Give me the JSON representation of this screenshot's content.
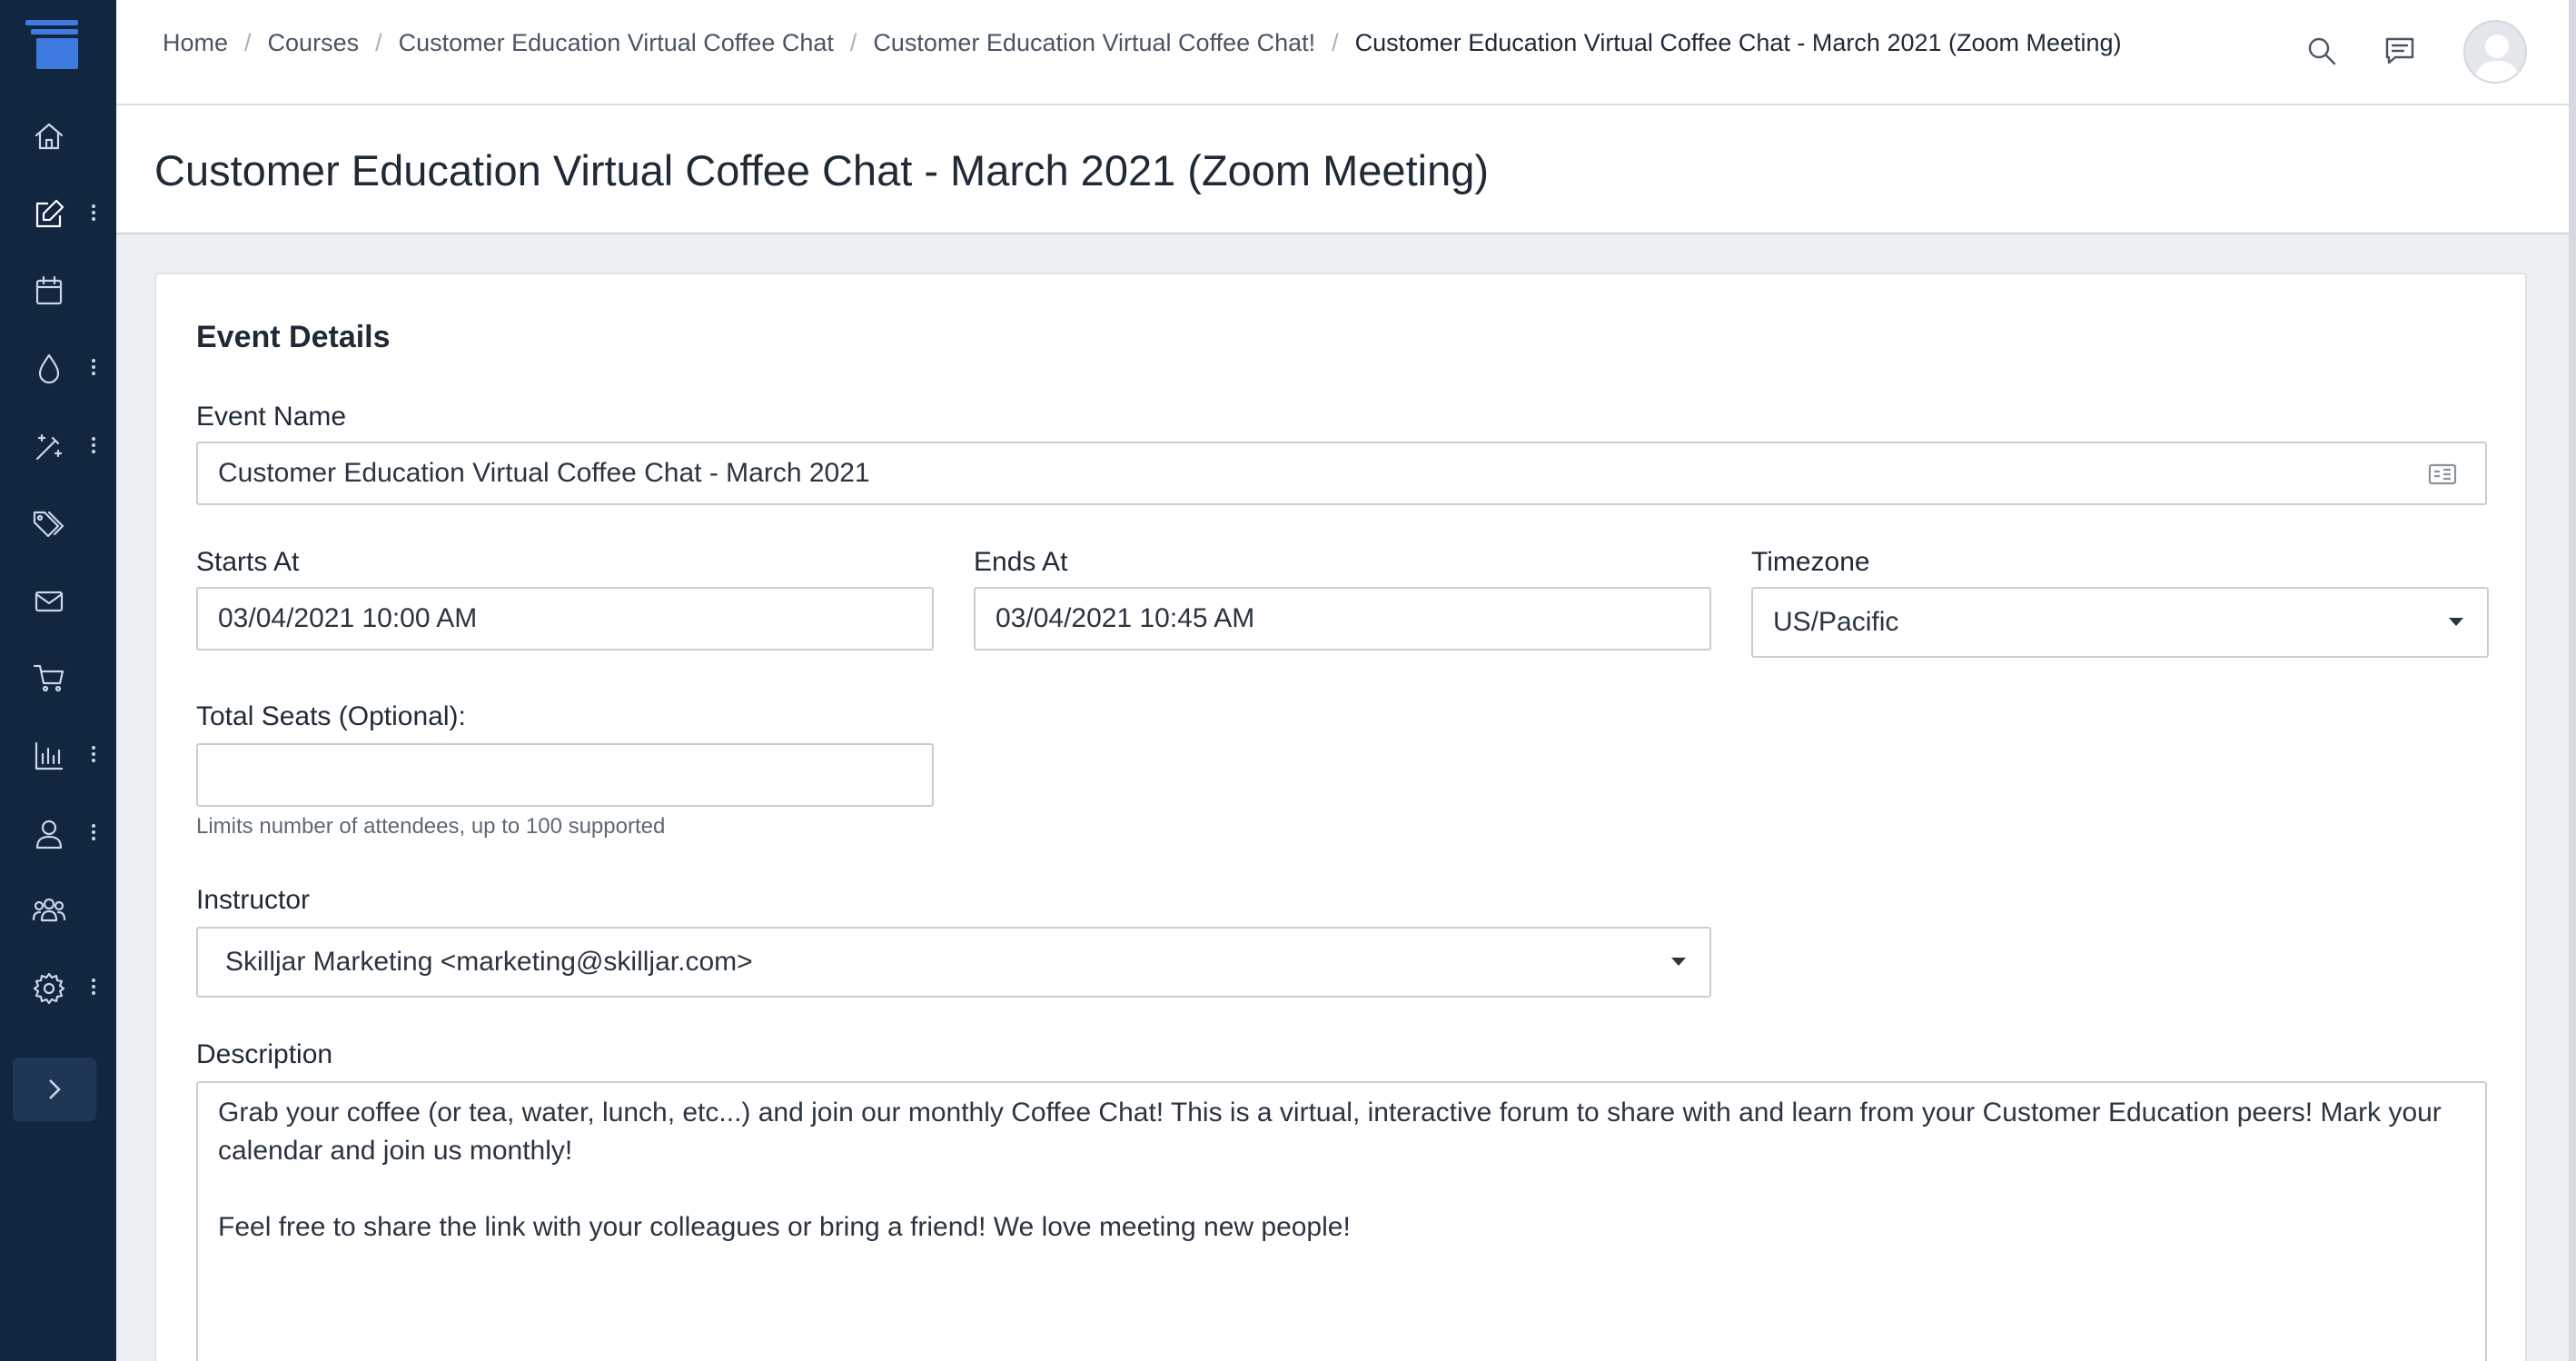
{
  "breadcrumb": {
    "items": [
      "Home",
      "Courses",
      "Customer Education Virtual Coffee Chat",
      "Customer Education Virtual Coffee Chat!"
    ],
    "current": "Customer Education Virtual Coffee Chat - March 2021 (Zoom Meeting)",
    "separator": "/"
  },
  "page": {
    "title": "Customer Education Virtual Coffee Chat - March 2021 (Zoom Meeting)"
  },
  "form": {
    "section_title": "Event Details",
    "event_name": {
      "label": "Event Name",
      "value": "Customer Education Virtual Coffee Chat - March 2021"
    },
    "starts_at": {
      "label": "Starts At",
      "value": "03/04/2021 10:00 AM"
    },
    "ends_at": {
      "label": "Ends At",
      "value": "03/04/2021 10:45 AM"
    },
    "timezone": {
      "label": "Timezone",
      "value": "US/Pacific"
    },
    "total_seats": {
      "label": "Total Seats (Optional):",
      "value": "",
      "hint": "Limits number of attendees, up to 100 supported"
    },
    "instructor": {
      "label": "Instructor",
      "value": "Skilljar Marketing <marketing@skilljar.com>"
    },
    "description": {
      "label": "Description",
      "paragraph_1": "Grab your coffee (or tea, water, lunch, etc...) and join our monthly Coffee Chat! This is a virtual, interactive forum to share with and learn from your Customer Education peers! Mark your calendar and join us monthly!",
      "paragraph_2": "Feel free to share the link with your colleagues or bring a friend! We love meeting new people!"
    }
  },
  "sidebar": {
    "icons": [
      "home-icon",
      "edit-icon",
      "calendar-icon",
      "droplet-icon",
      "magic-wand-icon",
      "tags-icon",
      "mail-icon",
      "cart-icon",
      "analytics-icon",
      "user-icon",
      "users-icon",
      "settings-icon"
    ]
  },
  "colors": {
    "sidebar_bg": "#122640",
    "accent": "#1f6fe0"
  }
}
